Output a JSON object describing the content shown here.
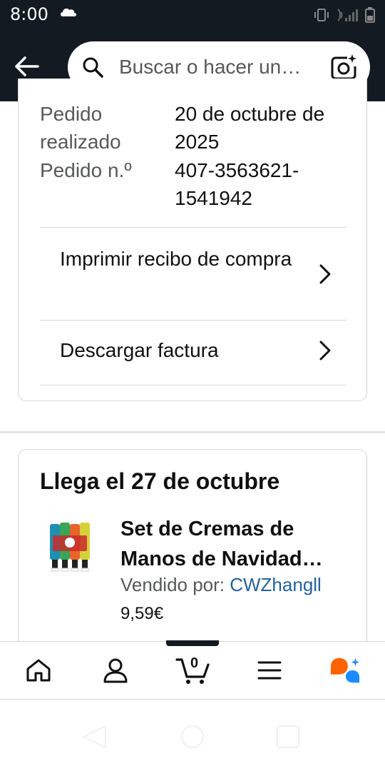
{
  "status_bar": {
    "time": "8:00"
  },
  "header": {
    "search_placeholder": "Buscar o hacer un…"
  },
  "order_info": {
    "date_label": "Pedido realizado",
    "date_value": "20 de octubre de 2025",
    "number_label": "Pedido n.º",
    "number_value": "407-3563621-1541942"
  },
  "actions": [
    {
      "label": "Imprimir recibo de compra"
    },
    {
      "label": "Descargar factura"
    }
  ],
  "delivery": {
    "title": "Llega el 27 de octubre",
    "product_title": "Set de Cremas de Manos de Navidad…",
    "seller_prefix": "Vendido por: ",
    "seller_name": "CWZhangll",
    "price": "9,59€"
  },
  "bottom_nav": {
    "cart_count": "0",
    "items": [
      "home-icon",
      "account-icon",
      "cart-icon",
      "menu-icon",
      "rufus-icon"
    ]
  },
  "colors": {
    "header_bg": "#131a22",
    "link": "#2162a1",
    "rufus_orange": "#ff6200",
    "rufus_blue": "#1a8cff"
  }
}
